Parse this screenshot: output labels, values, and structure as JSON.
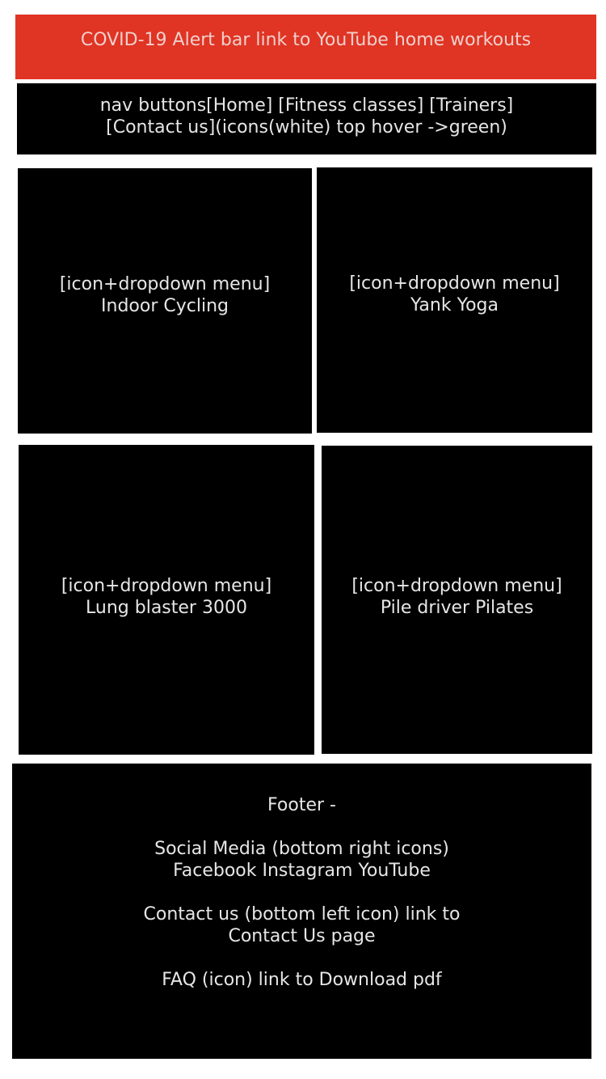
{
  "alert_bar": {
    "text": "COVID-19 Alert bar link to YouTube home workouts"
  },
  "nav": {
    "line1": "nav buttons[Home] [Fitness classes] [Trainers]",
    "line2": "[Contact us](icons(white) top hover ->green)"
  },
  "tiles": [
    {
      "menu_label": "[icon+dropdown menu]",
      "name": "Indoor Cycling"
    },
    {
      "menu_label": "[icon+dropdown menu]",
      "name": "Yank Yoga"
    },
    {
      "menu_label": "[icon+dropdown menu]",
      "name": "Lung blaster 3000"
    },
    {
      "menu_label": "[icon+dropdown menu]",
      "name": "Pile driver Pilates"
    }
  ],
  "footer": {
    "title": "Footer -",
    "social_line1": "Social Media (bottom right icons)",
    "social_line2": "Facebook Instagram YouTube",
    "contact_line1": "Contact us (bottom left icon) link to",
    "contact_line2": "Contact Us page",
    "faq_line": "FAQ (icon) link to Download pdf"
  },
  "colors": {
    "alert_bg": "#e03424",
    "block_bg": "#000000",
    "text": "#e6e6e6",
    "page_bg": "#ffffff"
  }
}
